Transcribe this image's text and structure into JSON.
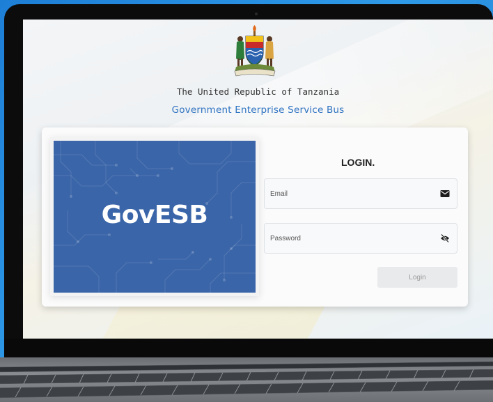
{
  "header": {
    "country": "The United Republic of Tanzania",
    "service": "Government Enterprise Service Bus"
  },
  "banner": {
    "brand": "GovESB"
  },
  "login": {
    "title": "LOGIN.",
    "email_placeholder": "Email",
    "password_placeholder": "Password",
    "button_label": "Login"
  },
  "icons": {
    "emblem": "tanzania-coat-of-arms-icon",
    "email": "envelope-icon",
    "password": "eye-off-icon"
  },
  "colors": {
    "accent": "#2f73c2",
    "banner": "#3a65a8",
    "button_disabled": "#e9eaec"
  }
}
